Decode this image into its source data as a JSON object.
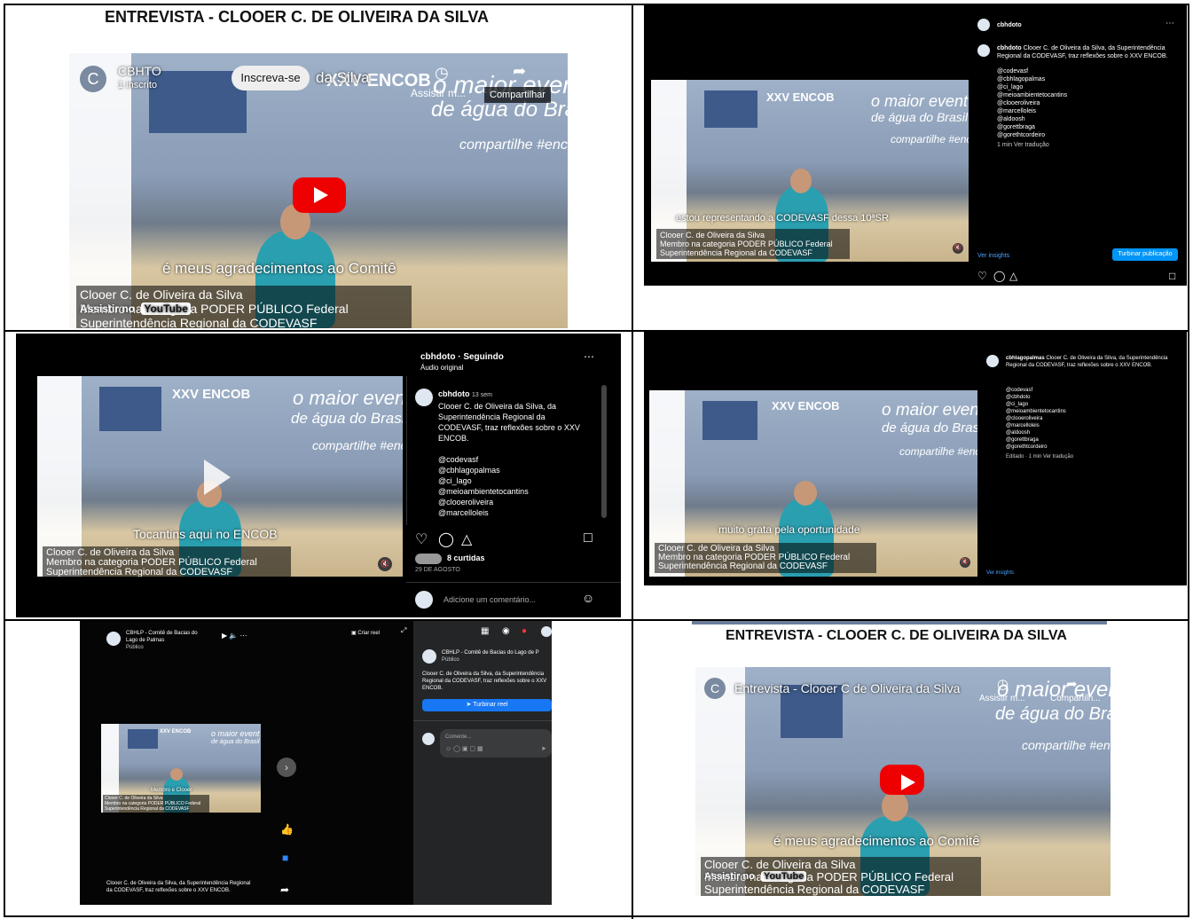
{
  "cell1": {
    "title": "ENTREVISTA - CLOOER C. DE OLIVEIRA DA SILVA",
    "channel_initial": "C",
    "channel_name": "CBHTO",
    "subscribers": "1 inscrito",
    "subscribe_label": "Inscreva-se",
    "title_overlay": "da Silva",
    "watch_later": "Assistir m...",
    "share_label": "Compartilhar",
    "caption": "é meus agradecimentos ao Comitê",
    "lower1": "Clooer C. de Oliveira da Silva",
    "lower2": "Membro na categoria PODER PÚBLICO Federal",
    "lower3": "Superintendência Regional da CODEVASF",
    "watch_on": "Assistir no",
    "youtube": "YouTube"
  },
  "banner": {
    "encob": "XXV ENCOB",
    "maior1": "o maior event",
    "maior2": "de água do Brasil",
    "compartilhe": "compartilhe #enc"
  },
  "cell2": {
    "username": "cbhdoto",
    "post_user": "cbhdoto",
    "post_text": "Clooer C. de Oliveira da Silva, da Superintendência Regional da CODEVASF, traz reflexões sobre o XXV ENCOB.",
    "tags": [
      "@codevasf",
      "@cbhlagopalmas",
      "@ci_lago",
      "@meioambientetocantins",
      "@clooeroliveira",
      "@marcelloleis",
      "@aldoosh",
      "@gorettbraga",
      "@gorethtcordeiro"
    ],
    "meta": "1 min   Ver tradução",
    "insights": "Ver insights",
    "boost": "Turbinar publicação",
    "caption": "estou representando a CODEVASF dessa 10ªSR",
    "lower1": "Clooer C. de Oliveira da Silva",
    "lower2": "Membro na categoria PODER PÚBLICO Federal",
    "lower3": "Superintendência Regional da CODEVASF"
  },
  "cell3": {
    "header_user": "cbhdoto · Seguindo",
    "audio": "Áudio original",
    "post_user": "cbhdoto",
    "post_time": "13 sem",
    "post_text1": "Clooer C. de Oliveira da Silva, da",
    "post_text2": "Superintendência Regional da",
    "post_text3": "CODEVASF, traz reflexões sobre o XXV",
    "post_text4": "ENCOB.",
    "tags": [
      "@codevasf",
      "@cbhlagopalmas",
      "@ci_lago",
      "@meioambientetocantins",
      "@clooeroliveira",
      "@marcelloleis"
    ],
    "likes": "8 curtidas",
    "date": "29 DE AGOSTO",
    "comment_placeholder": "Adicione um comentário...",
    "caption": "Tocantins aqui no ENCOB",
    "lower1": "Clooer C. de Oliveira da Silva",
    "lower2": "Membro na categoria PODER PÚBLICO Federal",
    "lower3": "Superintendência Regional da CODEVASF"
  },
  "cell4": {
    "post_user": "cbhlagopalmas",
    "post_text": "Clooer C. de Oliveira da Silva, da Superintendência Regional da CODEVASF, traz reflexões sobre o XXV ENCOB.",
    "tags": [
      "@codevasf",
      "@cbhdoto",
      "@ci_lago",
      "@meioambientetocantins",
      "@clooeroliveira",
      "@marcelloleis",
      "@aldoosh",
      "@gorettbraga",
      "@gorethtcordeiro"
    ],
    "meta": "Editado · 1 min   Ver tradução",
    "insights": "Ver insights",
    "caption": "muito grata pela oportunidade",
    "lower1": "Clooer C. de Oliveira da Silva",
    "lower2": "Membro na categoria PODER PÚBLICO Federal",
    "lower3": "Superintendência Regional da CODEVASF"
  },
  "cell5": {
    "page_name1": "CBHLP - Comitê de Bacias do",
    "page_name2": "Lago de Palmas",
    "public": "Público",
    "create_reel": "Criar reel",
    "side_name": "CBHLP - Comitê de Bacias do Lago de P",
    "side_public": "Público",
    "side_text": "Clooer C. de Oliveira da Silva, da Superintendência Regional da CODEVASF, traz reflexões sobre o XXV ENCOB.",
    "boost": "Turbinar reel",
    "comment_placeholder": "Comente...",
    "caption": "Membro e Clooer",
    "bottom_text": "Clooer C. de Oliveira da Silva, da Superintendência Regional da CODEVASF, traz reflexões sobre o XXV ENCOB.",
    "lower1": "Clooer C. de Oliveira da Silva",
    "lower2": "Membro na categoria PODER PÚBLICO Federal",
    "lower3": "Superintendência Regional da CODEVASF"
  },
  "cell6": {
    "title": "ENTREVISTA - CLOOER C. DE OLIVEIRA DA SILVA",
    "channel_initial": "C",
    "video_title": "Entrevista - Clooer C de Oliveira da Silva",
    "watch_later": "Assistir m...",
    "share_label": "Compartilh...",
    "caption": "é meus agradecimentos ao Comitê",
    "lower1": "Clooer C. de Oliveira da Silva",
    "lower2": "Membro na categoria PODER PÚBLICO Federal",
    "lower3": "Superintendência Regional da CODEVASF",
    "watch_on": "Assistir no",
    "youtube": "YouTube"
  }
}
